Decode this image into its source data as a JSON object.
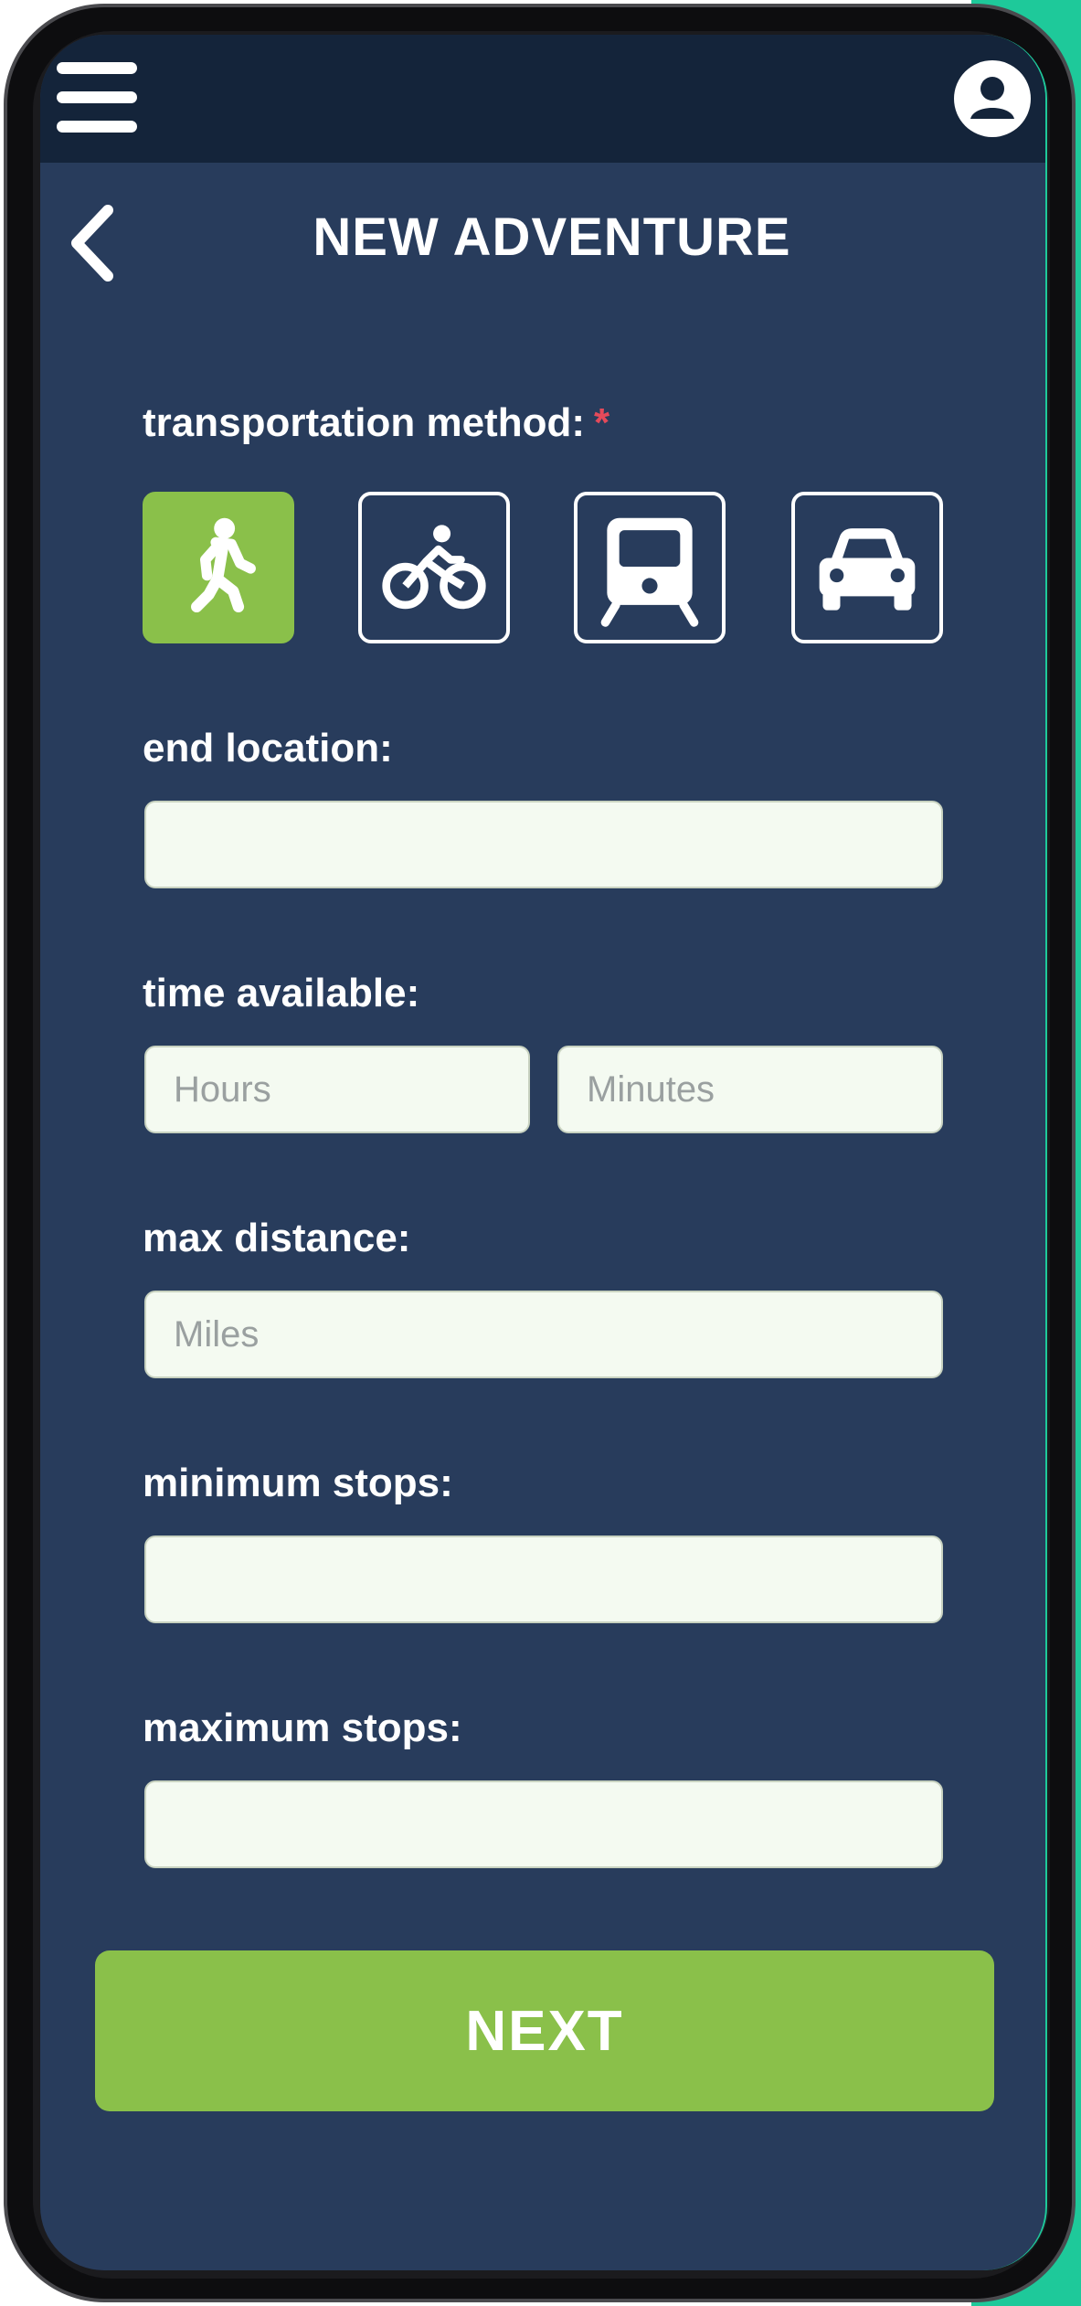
{
  "header": {
    "title": "NEW ADVENTURE",
    "menu_icon": "hamburger-menu-icon",
    "profile_icon": "user-profile-icon",
    "back_icon": "chevron-left-icon"
  },
  "form": {
    "transport": {
      "label": "transportation method:",
      "required_mark": "*",
      "options": [
        {
          "icon": "walking-icon",
          "selected": true
        },
        {
          "icon": "bicycle-icon",
          "selected": false
        },
        {
          "icon": "train-icon",
          "selected": false
        },
        {
          "icon": "car-icon",
          "selected": false
        }
      ]
    },
    "end_location": {
      "label": "end location:",
      "value": "",
      "placeholder": ""
    },
    "time_available": {
      "label": "time available:",
      "hours_placeholder": "Hours",
      "minutes_placeholder": "Minutes"
    },
    "max_distance": {
      "label": "max distance:",
      "placeholder": "Miles"
    },
    "minimum_stops": {
      "label": "minimum stops:",
      "value": "",
      "placeholder": ""
    },
    "maximum_stops": {
      "label": "maximum stops:",
      "value": "",
      "placeholder": ""
    }
  },
  "next_button": {
    "label": "NEXT"
  },
  "colors": {
    "screen_bg": "#283c5c",
    "topbar_bg": "#14243a",
    "accent_green": "#8ac04a",
    "required_red": "#e44a5a",
    "input_bg": "#f4faf1"
  }
}
